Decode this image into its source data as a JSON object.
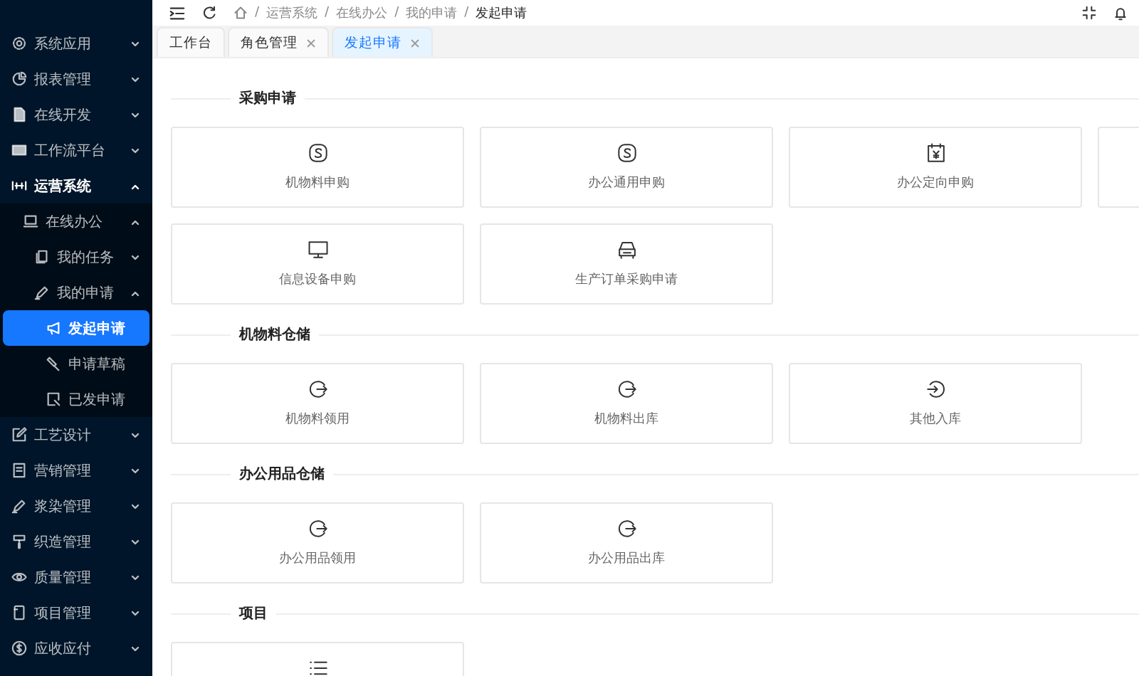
{
  "sidebar": {
    "items": [
      {
        "label": "系统应用",
        "kind": "gear",
        "expanded": false,
        "selected": false
      },
      {
        "label": "报表管理",
        "kind": "pie",
        "expanded": false,
        "selected": false
      },
      {
        "label": "在线开发",
        "kind": "file",
        "expanded": false,
        "selected": false
      },
      {
        "label": "工作流平台",
        "kind": "card",
        "expanded": false,
        "selected": false
      },
      {
        "label": "运营系统",
        "kind": "flow",
        "expanded": true,
        "selected": false,
        "children": [
          {
            "label": "在线办公",
            "kind": "laptop",
            "expanded": true,
            "selected": false,
            "children": [
              {
                "label": "我的任务",
                "kind": "copy",
                "expanded": false,
                "selected": false
              },
              {
                "label": "我的申请",
                "kind": "pen",
                "expanded": true,
                "selected": false,
                "children": [
                  {
                    "label": "发起申请",
                    "kind": "send",
                    "selected": true
                  },
                  {
                    "label": "申请草稿",
                    "kind": "draft",
                    "selected": false
                  },
                  {
                    "label": "已发申请",
                    "kind": "doc",
                    "selected": false
                  }
                ]
              }
            ]
          }
        ]
      },
      {
        "label": "工艺设计",
        "kind": "edit",
        "expanded": false,
        "selected": false
      },
      {
        "label": "营销管理",
        "kind": "book",
        "expanded": false,
        "selected": false
      },
      {
        "label": "浆染管理",
        "kind": "pen",
        "expanded": false,
        "selected": false
      },
      {
        "label": "织造管理",
        "kind": "roller",
        "expanded": false,
        "selected": false
      },
      {
        "label": "质量管理",
        "kind": "eye",
        "expanded": false,
        "selected": false
      },
      {
        "label": "项目管理",
        "kind": "phone",
        "expanded": false,
        "selected": false
      },
      {
        "label": "应收应付",
        "kind": "dollar",
        "expanded": false,
        "selected": false
      }
    ]
  },
  "breadcrumb": [
    {
      "separator": "/",
      "label": "运营系统"
    },
    {
      "separator": "/",
      "label": "在线办公"
    },
    {
      "separator": "/",
      "label": "我的申请"
    },
    {
      "separator": "/",
      "label": "发起申请"
    }
  ],
  "tabs": [
    {
      "label": "工作台",
      "closable": false,
      "selected": false
    },
    {
      "label": "角色管理",
      "closable": true,
      "selected": false
    },
    {
      "label": "发起申请",
      "closable": true,
      "selected": true
    }
  ],
  "sections": [
    {
      "title": "采购申请",
      "cards": [
        {
          "label": "机物料申购",
          "kind": "slogo"
        },
        {
          "label": "办公通用申购",
          "kind": "slogo"
        },
        {
          "label": "办公定向申购",
          "kind": "calendar"
        },
        {
          "kind": "clipped"
        },
        {
          "label": "信息设备申购",
          "kind": "monitor"
        },
        {
          "label": "生产订单采购申请",
          "kind": "car"
        }
      ]
    },
    {
      "title": "机物料仓储",
      "cards": [
        {
          "label": "机物料领用",
          "kind": "exit"
        },
        {
          "label": "机物料出库",
          "kind": "exit"
        },
        {
          "label": "其他入库",
          "kind": "enter"
        }
      ]
    },
    {
      "title": "办公用品仓储",
      "cards": [
        {
          "label": "办公用品领用",
          "kind": "exit"
        },
        {
          "label": "办公用品出库",
          "kind": "exit"
        }
      ]
    },
    {
      "title": "项目",
      "cards": [
        {
          "kind": "list"
        }
      ]
    }
  ]
}
